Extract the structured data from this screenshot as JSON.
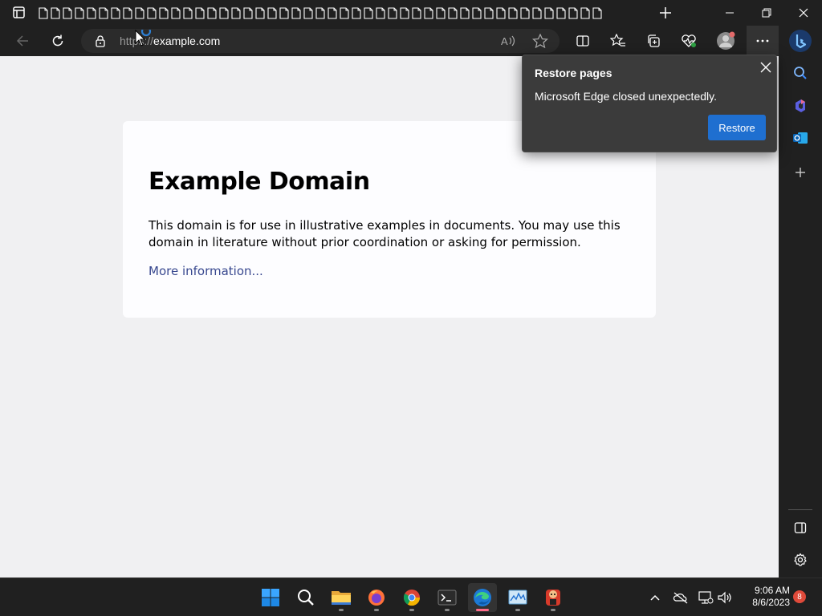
{
  "browser": {
    "tab_count": 47,
    "address": {
      "scheme_text": "https://",
      "host_text": "example.com"
    }
  },
  "page": {
    "heading": "Example Domain",
    "paragraph": "This domain is for use in illustrative examples in documents. You may use this domain in literature without prior coordination or asking for permission.",
    "link": "More information..."
  },
  "popup": {
    "title": "Restore pages",
    "message": "Microsoft Edge closed unexpectedly.",
    "restore_label": "Restore"
  },
  "taskbar": {
    "time": "9:06 AM",
    "date": "8/6/2023",
    "notification_count": "8",
    "apps": [
      "start-icon",
      "search-icon",
      "file-explorer-icon",
      "firefox-icon",
      "chrome-icon",
      "terminal-icon",
      "edge-icon",
      "task-manager-icon",
      "game-icon"
    ]
  },
  "colors": {
    "accent": "#1f6fd0",
    "page_bg": "#f0f0f2",
    "link": "#38488f"
  }
}
